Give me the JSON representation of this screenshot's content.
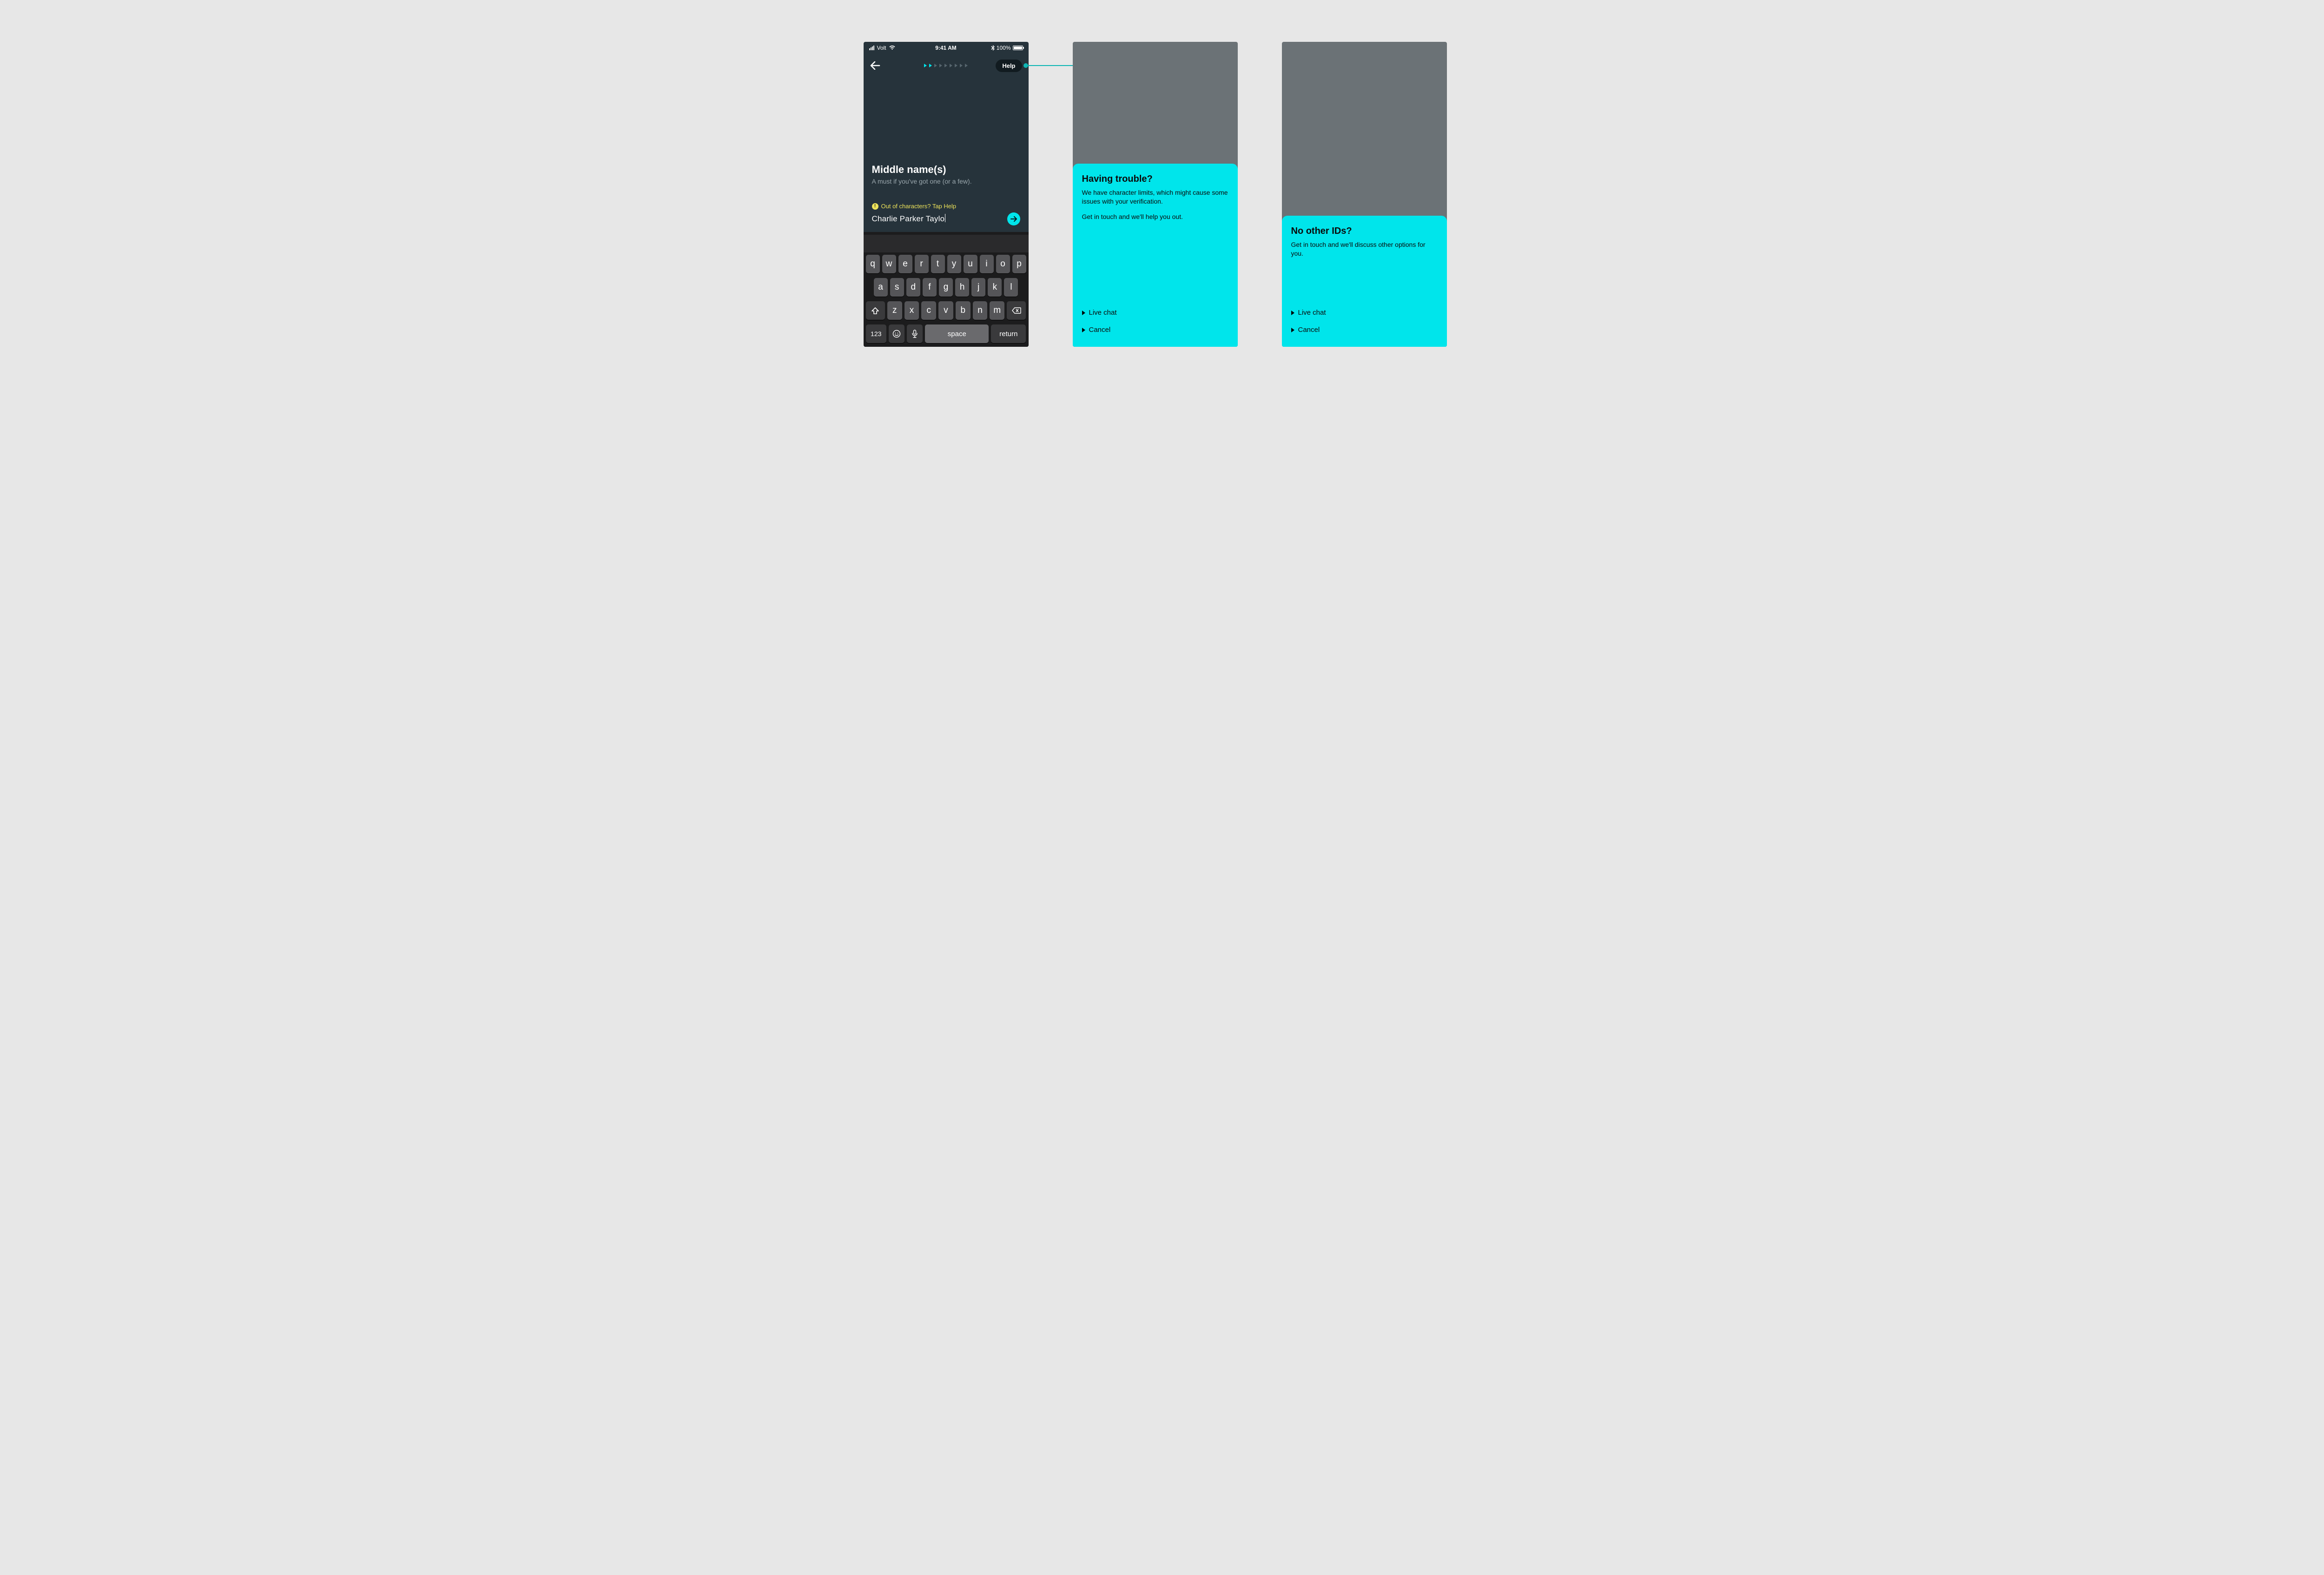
{
  "status": {
    "carrier": "Volt",
    "time": "9:41 AM",
    "battery": "100%",
    "bluetooth": "✱"
  },
  "nav": {
    "help_label": "Help",
    "progress_total": 9,
    "progress_done": 2
  },
  "form": {
    "title": "Middle name(s)",
    "subtitle": "A must if you've got one (or a few).",
    "hint": "Out of characters? Tap Help",
    "value": "Charlie Parker Taylo"
  },
  "keyboard": {
    "row1": [
      "q",
      "w",
      "e",
      "r",
      "t",
      "y",
      "u",
      "i",
      "o",
      "p"
    ],
    "row2": [
      "a",
      "s",
      "d",
      "f",
      "g",
      "h",
      "j",
      "k",
      "l"
    ],
    "row3": [
      "z",
      "x",
      "c",
      "v",
      "b",
      "n",
      "m"
    ],
    "numbers": "123",
    "space": "space",
    "return": "return"
  },
  "sheet1": {
    "title": "Having trouble?",
    "body1": "We have character limits, which might cause some issues with your verification.",
    "body2": "Get in touch and we'll help you out.",
    "action_primary": "Live chat",
    "action_cancel": "Cancel"
  },
  "sheet2": {
    "title": "No other IDs?",
    "body1": "Get in touch and we'll discuss other options for you.",
    "action_primary": "Live chat",
    "action_cancel": "Cancel"
  }
}
